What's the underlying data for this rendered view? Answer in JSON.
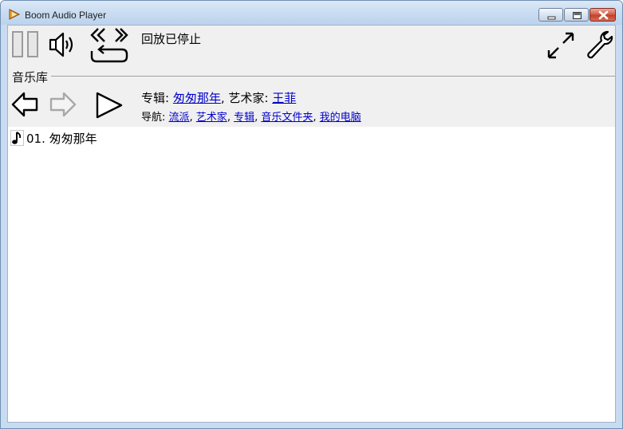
{
  "window": {
    "title": "Boom Audio Player"
  },
  "toolbar": {
    "status": "回放已停止"
  },
  "library": {
    "section_label": "音乐库",
    "album_prefix": "专辑: ",
    "album_name": "匆匆那年",
    "artist_separator": ", 艺术家: ",
    "artist_name": "王菲",
    "nav_prefix": "导航: ",
    "nav_links": [
      "流派",
      "艺术家",
      "专辑",
      "音乐文件夹",
      "我的电脑"
    ],
    "nav_separator": ", "
  },
  "tracks": [
    {
      "label": "01. 匆匆那年"
    }
  ],
  "icons": {
    "app": "play-triangle-icon",
    "pause": "pause-icon",
    "volume": "speaker-icon",
    "shuffle_repeat": "repeat-icon",
    "back": "back-arrow-icon",
    "forward": "forward-arrow-icon",
    "play": "play-icon",
    "fullscreen": "expand-icon",
    "settings": "wrench-icon",
    "track": "music-note-icon"
  },
  "colors": {
    "link": "#0000cc",
    "toolbar_bg": "#f0f0f0",
    "close_button": "#c2412a"
  }
}
